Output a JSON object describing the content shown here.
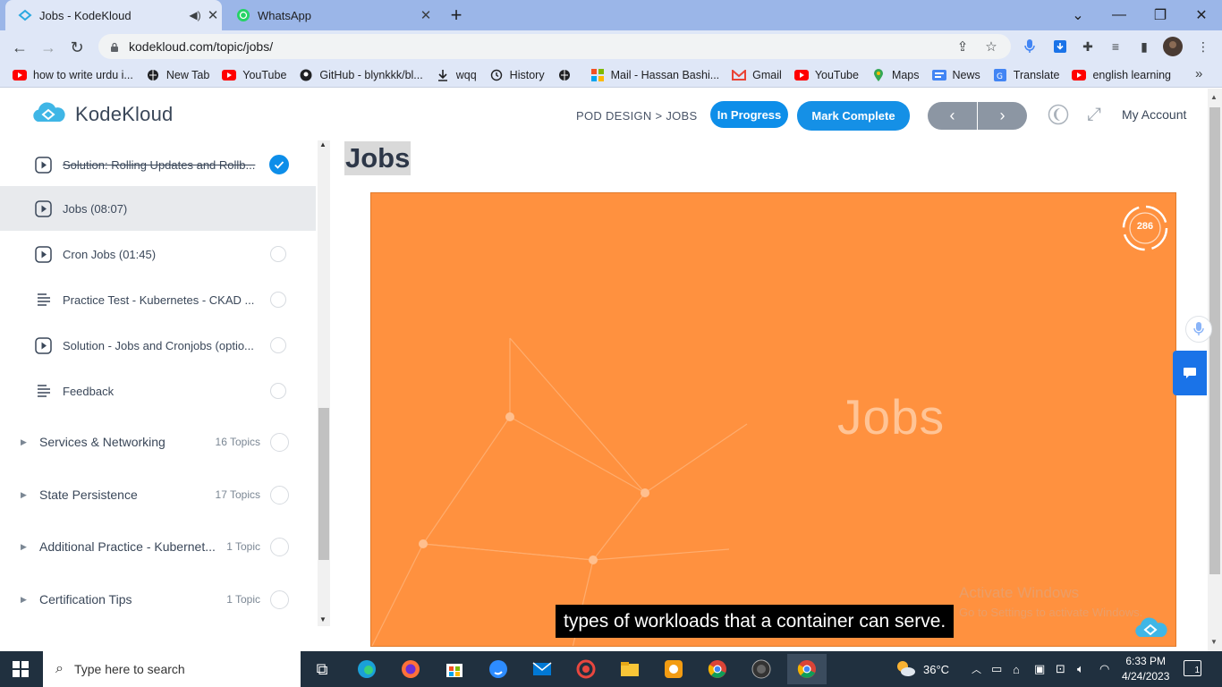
{
  "browser": {
    "tabs": [
      {
        "title": "Jobs - KodeKloud",
        "active": true
      },
      {
        "title": "WhatsApp",
        "active": false
      }
    ],
    "new_tab_symbol": "+",
    "url": "kodekloud.com/topic/jobs/",
    "bookmarks": [
      {
        "label": "how to write urdu i...",
        "icon": "youtube-icon"
      },
      {
        "label": "New Tab",
        "icon": "globe-icon"
      },
      {
        "label": "YouTube",
        "icon": "youtube-icon"
      },
      {
        "label": "GitHub - blynkkk/bl...",
        "icon": "github-icon"
      },
      {
        "label": "wqq",
        "icon": "download-icon"
      },
      {
        "label": "History",
        "icon": "history-icon"
      },
      {
        "label": "",
        "icon": "globe-icon"
      },
      {
        "label": "Mail - Hassan Bashi...",
        "icon": "microsoft-icon"
      },
      {
        "label": "Gmail",
        "icon": "gmail-icon"
      },
      {
        "label": "YouTube",
        "icon": "youtube-icon"
      },
      {
        "label": "Maps",
        "icon": "maps-icon"
      },
      {
        "label": "News",
        "icon": "news-icon"
      },
      {
        "label": "Translate",
        "icon": "translate-icon"
      },
      {
        "label": "english learning",
        "icon": "youtube-icon"
      }
    ]
  },
  "header": {
    "logo_text": "KodeKloud",
    "breadcrumb": "POD DESIGN > JOBS",
    "in_progress_label": "In Progress",
    "mark_complete_label": "Mark Complete",
    "prev_symbol": "‹",
    "next_symbol": "›",
    "account_label": "My Account"
  },
  "sidebar": {
    "lessons": [
      {
        "title": "Solution: Rolling Updates and Rollb...",
        "type": "video",
        "completed": true,
        "current": false
      },
      {
        "title": "Jobs (08:07)",
        "type": "video",
        "completed": false,
        "current": true
      },
      {
        "title": "Cron Jobs (01:45)",
        "type": "video",
        "completed": false,
        "current": false
      },
      {
        "title": "Practice Test - Kubernetes - CKAD ...",
        "type": "text",
        "completed": false,
        "current": false
      },
      {
        "title": "Solution - Jobs and Cronjobs (optio...",
        "type": "video",
        "completed": false,
        "current": false
      },
      {
        "title": "Feedback",
        "type": "text",
        "completed": false,
        "current": false
      }
    ],
    "sections": [
      {
        "title": "Services & Networking",
        "count": "16 Topics"
      },
      {
        "title": "State Persistence",
        "count": "17 Topics"
      },
      {
        "title": "Additional Practice - Kubernet...",
        "count": "1 Topic"
      },
      {
        "title": "Certification Tips",
        "count": "1 Topic"
      }
    ]
  },
  "main": {
    "page_title": "Jobs",
    "video": {
      "slide_title": "Jobs",
      "timer_value": "286",
      "subtitle": "types of workloads that a container can serve.",
      "watermark_line1": "Activate Windows",
      "watermark_line2": "Go to Settings to activate Windows."
    }
  },
  "taskbar": {
    "search_placeholder": "Type here to search",
    "temperature": "36°C",
    "time": "6:33 PM",
    "date": "4/24/2023",
    "notification_count": "1"
  },
  "colors": {
    "accent": "#0d8ee9",
    "video_bg": "#ff913f",
    "tab_strip": "#9bb6e8"
  }
}
